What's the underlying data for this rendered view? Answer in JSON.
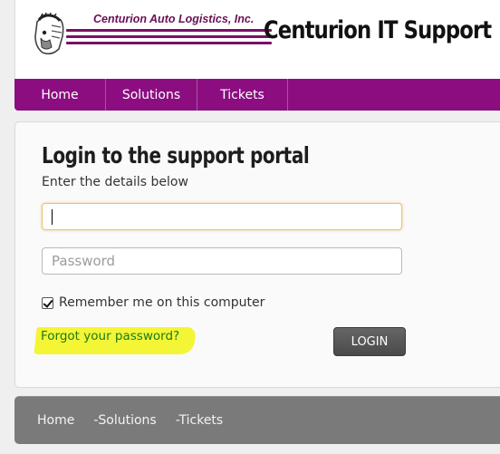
{
  "header": {
    "logo_text": "Centurion Auto Logistics, Inc.",
    "site_title": "Centurion IT Support"
  },
  "nav": {
    "items": [
      {
        "label": "Home"
      },
      {
        "label": "Solutions"
      },
      {
        "label": "Tickets"
      }
    ]
  },
  "login": {
    "title": "Login to the support portal",
    "subtitle": "Enter the details below",
    "username_value": "",
    "password_placeholder": "Password",
    "remember_label": "Remember me on this computer",
    "remember_checked": true,
    "forgot_link": "Forgot your password?",
    "login_button": "LOGIN"
  },
  "footer": {
    "links": [
      {
        "label": "Home"
      },
      {
        "label": "-Solutions"
      },
      {
        "label": "-Tickets"
      }
    ]
  },
  "colors": {
    "nav_bg": "#8b0d80",
    "logo_purple": "#7a1066",
    "link_green": "#1a7a1a",
    "highlight_yellow": "#f3f41f",
    "footer_bg": "#7a7a7a"
  },
  "icons": {
    "logo": "spartan-helmet-icon",
    "checkbox": "checkmark-icon"
  }
}
